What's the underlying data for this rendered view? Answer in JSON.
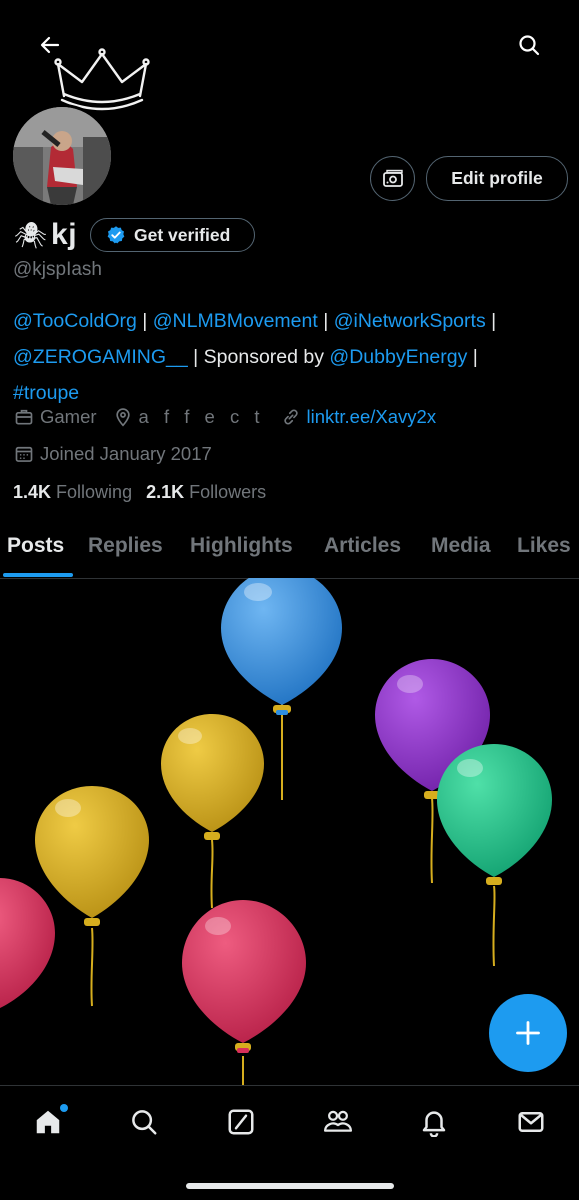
{
  "header": {
    "back_icon": "arrow-left-icon",
    "search_icon": "search-icon",
    "banner_decoration": "neon-crown"
  },
  "profile": {
    "name_emoji": "🕷",
    "name": "kj",
    "get_verified_label": "Get verified",
    "handle": "@kjspIash",
    "edit_profile_label": "Edit profile",
    "bio": {
      "line1": [
        {
          "text": "@TooColdOrg",
          "link": true
        },
        {
          "text": " | ",
          "link": false
        },
        {
          "text": "@NLMBMovement",
          "link": true
        },
        {
          "text": " | ",
          "link": false
        },
        {
          "text": "@iNetworkSports",
          "link": true
        },
        {
          "text": " |",
          "link": false
        }
      ],
      "line2": [
        {
          "text": "@ZEROGAMING__",
          "link": true
        },
        {
          "text": " | Sponsored by ",
          "link": false
        },
        {
          "text": "@DubbyEnergy",
          "link": true
        },
        {
          "text": " |",
          "link": false
        }
      ],
      "line3": [
        {
          "text": "#troupe",
          "link": true
        }
      ]
    },
    "category": "Gamer",
    "location": "a f f e c t",
    "website": "linktr.ee/Xavy2x",
    "joined": "Joined January 2017",
    "following_count": "1.4K",
    "following_label": "Following",
    "followers_count": "2.1K",
    "followers_label": "Followers"
  },
  "tabs": [
    {
      "label": "Posts",
      "active": true
    },
    {
      "label": "Replies",
      "active": false
    },
    {
      "label": "Highlights",
      "active": false
    },
    {
      "label": "Articles",
      "active": false
    },
    {
      "label": "Media",
      "active": false
    },
    {
      "label": "Likes",
      "active": false
    }
  ],
  "balloon_colors": {
    "blue": "#2f8fe0",
    "purple": "#8a2fc8",
    "yellow": "#d6ae1e",
    "green": "#19c28a",
    "red": "#d9305a"
  },
  "fab_icon": "plus-icon",
  "bottom_nav": [
    {
      "icon": "home-icon",
      "active": true,
      "notification_dot": true
    },
    {
      "icon": "search-icon",
      "active": false
    },
    {
      "icon": "grok-icon",
      "active": false
    },
    {
      "icon": "communities-icon",
      "active": false
    },
    {
      "icon": "bell-icon",
      "active": false
    },
    {
      "icon": "mail-icon",
      "active": false
    }
  ],
  "colors": {
    "accent": "#1d9bf0",
    "text_primary": "#e7e9ea",
    "text_secondary": "#71767b",
    "border": "#2f3336",
    "background": "#000000"
  }
}
